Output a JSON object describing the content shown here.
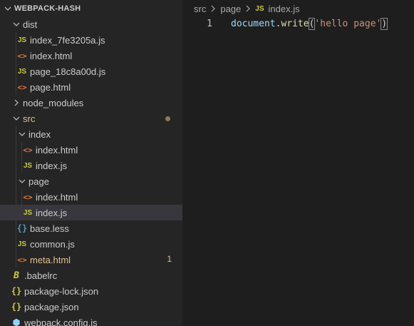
{
  "explorer": {
    "root_title": "WEBPACK-HASH",
    "items": [
      {
        "label": "dist",
        "type": "folder"
      },
      {
        "label": "index_7fe3205a.js",
        "icon": "JS"
      },
      {
        "label": "index.html",
        "icon": "<>"
      },
      {
        "label": "page_18c8a00d.js",
        "icon": "JS"
      },
      {
        "label": "page.html",
        "icon": "<>"
      },
      {
        "label": "node_modules",
        "type": "folder"
      },
      {
        "label": "src",
        "type": "folder",
        "modified": true
      },
      {
        "label": "index",
        "type": "folder"
      },
      {
        "label": "index.html",
        "icon": "<>"
      },
      {
        "label": "index.js",
        "icon": "JS"
      },
      {
        "label": "page",
        "type": "folder"
      },
      {
        "label": "index.html",
        "icon": "<>"
      },
      {
        "label": "index.js",
        "icon": "JS",
        "selected": true
      },
      {
        "label": "base.less",
        "icon": "{}"
      },
      {
        "label": "common.js",
        "icon": "JS"
      },
      {
        "label": "meta.html",
        "icon": "<>",
        "problems": "1"
      },
      {
        "label": ".babelrc",
        "icon": "B"
      },
      {
        "label": "package-lock.json",
        "icon": "{}"
      },
      {
        "label": "package.json",
        "icon": "{}"
      },
      {
        "label": "webpack.config.js",
        "icon": "⬢"
      }
    ]
  },
  "editor": {
    "breadcrumb": [
      "src",
      "page",
      "index.js"
    ],
    "breadcrumb_file_icon": "JS",
    "line_number": "1",
    "code": {
      "object": "document",
      "dot": ".",
      "method": "write",
      "open_paren": "(",
      "string": "'hello page'",
      "close_paren": ")"
    }
  },
  "colors": {
    "sidebar_bg": "#252526",
    "editor_bg": "#1e1e1e",
    "selected_row": "#37373d",
    "js_icon": "#cbcb41",
    "html_icon": "#e37933",
    "modified_text": "#e2c08d"
  }
}
